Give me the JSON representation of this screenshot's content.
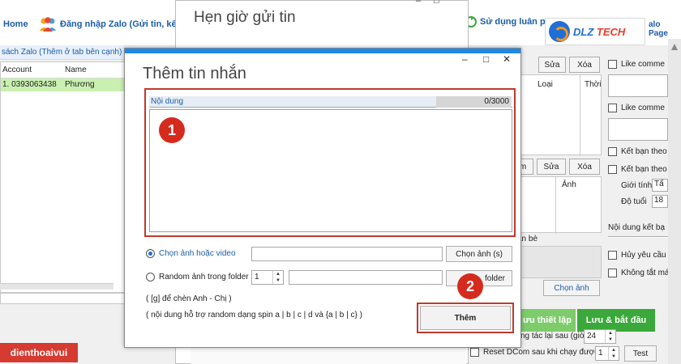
{
  "main_app": {
    "home_label": "Home",
    "zalo_login_label": "Đăng nhập Zalo (Gửi tin, kết",
    "account_tab_label": "sách Zalo (Thêm ở tab bên cạnh)",
    "right_tab_label": "Sử dụng luân phiê",
    "zalo_page_label": "alo Page",
    "account_table": {
      "headers": [
        "Account",
        "Name"
      ],
      "rows": [
        {
          "account": "1. 0393063438",
          "name": "Phương"
        }
      ]
    },
    "right_panel": {
      "buttons_top": [
        "Sửa",
        "Xóa"
      ],
      "grid_top_headers": [
        "Loại",
        "Thời"
      ],
      "buttons_mid": [
        "m",
        "Sửa",
        "Xóa"
      ],
      "grid_mid_header": "Ảnh",
      "friend_label": "ạn bè",
      "choose_image": "Chọn ảnh",
      "checkbox_like_1": "Like comme",
      "checkbox_like_2": "Like comme",
      "checkbox_friend_1": "Kết bạn theo",
      "checkbox_friend_2": "Kết bạn theo",
      "gender_label": "Giới tính",
      "gender_value": "Tấ",
      "age_label": "Độ tuổi",
      "age_value": "18",
      "friend_content_label": "Nội dung kết bạ",
      "checkbox_cancel": "Hủy yêu cầu",
      "checkbox_nokill": "Không tắt má"
    },
    "bottom": {
      "setup_label": "ưu thiết lập",
      "save_start_label": "Lưu & bắt đầu",
      "repeat_label": "ng tác lại sau (giờ)",
      "repeat_value": "24",
      "reset_label": "Reset DCom sau khi chạy được",
      "reset_value": "1",
      "test_label": "Test"
    }
  },
  "logo": {
    "brand": "DLZ",
    "brand_tail": "TECH"
  },
  "watermark": "dienthoaivui",
  "schedule_dialog": {
    "title": "Hẹn giờ gửi tin",
    "controls": [
      "–",
      "□"
    ]
  },
  "add_dialog": {
    "title": "Thêm tin nhắn",
    "controls": {
      "minimize": "–",
      "maximize": "□",
      "close": "✕"
    },
    "content_label": "Nội dung",
    "char_count": "0/3000",
    "badge_1": "1",
    "badge_2": "2",
    "radio_choose_media": "Chọn ảnh hoặc video",
    "choose_media_button": "Chọn ảnh (s)",
    "radio_random_folder": "Random ảnh trong folder",
    "random_count": "1",
    "folder_button": "folder",
    "hint_1": "( [g] để chèn Anh - Chị )",
    "hint_2": "( nội dung hỗ trợ random dạng spin a | b | c | d và {a | b | c} )",
    "add_button": "Thêm"
  }
}
